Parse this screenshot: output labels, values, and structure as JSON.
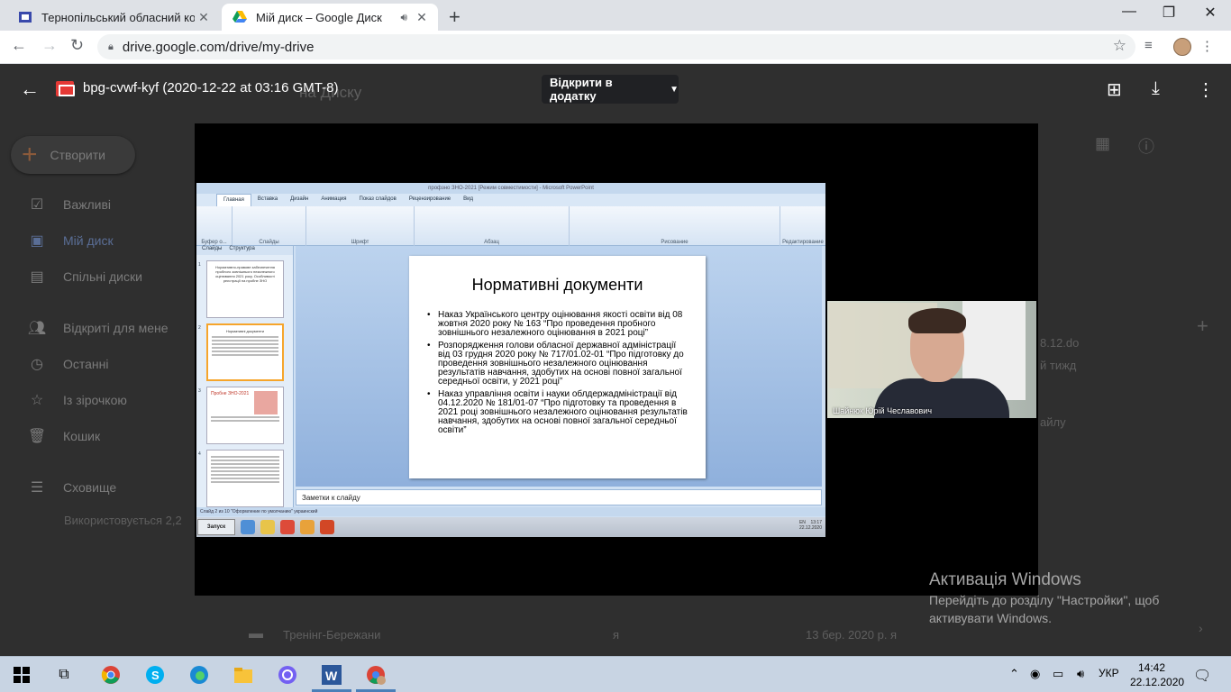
{
  "browser": {
    "tabs": [
      {
        "title": "Тернопільський обласний кому",
        "icon": "school-favicon-icon"
      },
      {
        "title": "Мій диск – Google Диск",
        "icon": "google-drive-icon",
        "audio": true
      }
    ],
    "url": "drive.google.com/drive/my-drive"
  },
  "drive": {
    "create_label": "Створити",
    "sidebar": [
      {
        "label": "Важливі",
        "icon": "check-box-icon"
      },
      {
        "label": "Мій диск",
        "icon": "my-drive-icon"
      },
      {
        "label": "Спільні диски",
        "icon": "shared-drives-icon"
      },
      {
        "label": "Відкриті для мене",
        "icon": "people-icon"
      },
      {
        "label": "Останні",
        "icon": "clock-icon"
      },
      {
        "label": "Із зірочкою",
        "icon": "star-icon"
      },
      {
        "label": "Кошик",
        "icon": "trash-icon"
      },
      {
        "label": "Сховище",
        "icon": "storage-icon"
      }
    ],
    "storage_text": "Використовується 2,2",
    "header_text": "на Диску",
    "file_row": {
      "name": "Тренінг-Бережани",
      "owner": "я",
      "date": "13 бер. 2020 р.",
      "modifier": "я"
    },
    "partial_texts": {
      "file_ext": "8.12.do",
      "file_sub": "й тижд",
      "list_suffix": "айлу"
    }
  },
  "viewer": {
    "file_title": "bpg-cvwf-kyf (2020-12-22 at 03:16 GMT-8)",
    "open_with_label": "Відкрити в додатку"
  },
  "presentation": {
    "window_title": "профзно ЗНО-2021 [Режим совместимости] - Microsoft PowerPoint",
    "menu": [
      "Главная",
      "Вставка",
      "Дизайн",
      "Анимация",
      "Показ слайдов",
      "Рецензирование",
      "Вид"
    ],
    "ribbon_groups": [
      "Буфер о...",
      "Слайды",
      "Шрифт",
      "Абзац",
      "Рисование",
      "Редактирование"
    ],
    "panel_tabs": [
      "Слайды",
      "Структура"
    ],
    "slide_title": "Нормативні документи",
    "bullets": [
      "Наказ Українського центру оцінювання якості освіти від 08 жовтня 2020 року № 163 “Про проведення пробного зовнішнього незалежного оцінювання в 2021 році”",
      "Розпорядження голови обласної державної адміністрації від 03 грудня 2020 року № 717/01.02-01 “Про підготовку до проведення зовнішнього незалежного оцінювання результатів навчання, здобутих на основі повної загальної середньої освіти, у 2021 році”",
      "Наказ управління освіти і науки облдержадміністрації від 04.12.2020 № 181/01-07 “Про підготовку та проведення в 2021  році зовнішнього незалежного оцінювання результатів навчання, здобутих на основі повної загальної середньої освіти”"
    ],
    "thumb1_text": "Нормативно-правове забезпечення пробного зовнішнього незалежного оцінювання 2021 року. Особливості реєстрації на пробне ЗНО",
    "thumb2_text": "Нормативні документи",
    "thumb3_text": "Пробне ЗНО-2021",
    "notes_placeholder": "Заметки к слайду",
    "status_text": "Слайд 2 из 10   \"Оформление по умолчанию\"   украинский",
    "xp_start": "Запуск",
    "xp_tray_time": "13:17",
    "xp_tray_date": "22.12.2020",
    "xp_lang": "EN"
  },
  "webcam": {
    "name": "Шайнюк Юрій Чеславович"
  },
  "activation": {
    "title": "Активація Windows",
    "line2": "Перейдіть до розділу \"Настройки\", щоб",
    "line3": "активувати Windows."
  },
  "taskbar": {
    "lang": "УКР",
    "time": "14:42",
    "date": "22.12.2020"
  },
  "colors": {
    "accent": "#4a7fb8",
    "pdf_red": "#e53935"
  }
}
